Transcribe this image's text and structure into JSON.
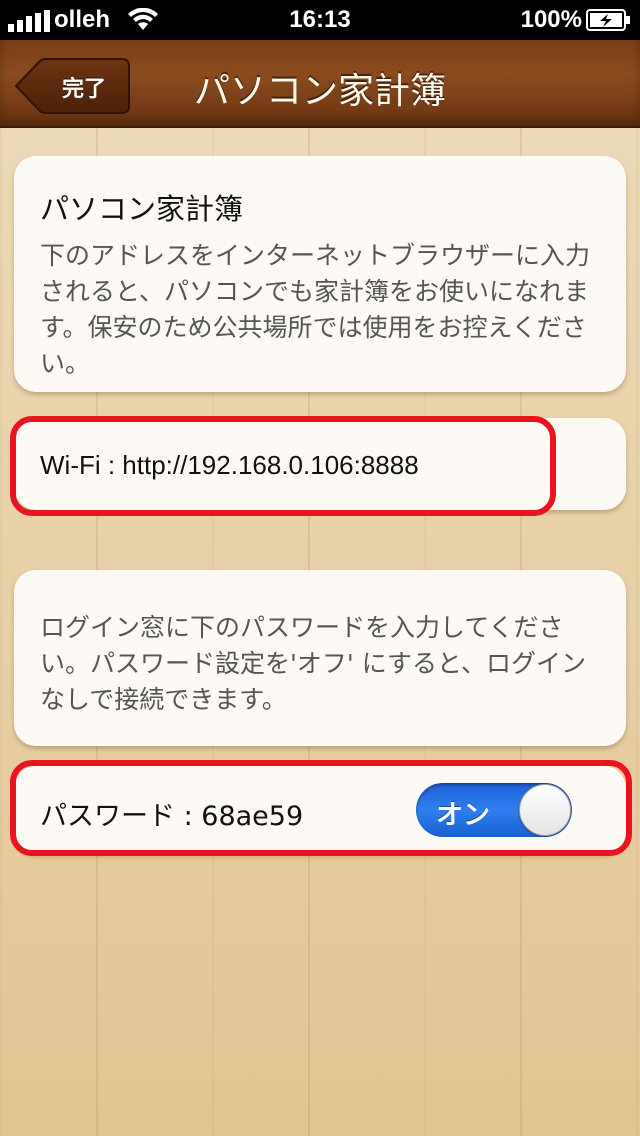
{
  "status_bar": {
    "carrier": "olleh",
    "time": "16:13",
    "battery": "100%"
  },
  "nav": {
    "back_label": "完了",
    "title": "パソコン家計簿"
  },
  "intro": {
    "title": "パソコン家計簿",
    "description": "下のアドレスをインターネットブラウザーに入力されると、パソコンでも家計簿をお使いになれます。保安のため公共場所では使用をお控えください。"
  },
  "wifi": {
    "url": "Wi-Fi : http://192.168.0.106:8888"
  },
  "password_section": {
    "description": "ログイン窓に下のパスワードを入力してください。パスワード設定を'オフ' にすると、ログインなしで接続できます。",
    "label": "パスワード : 68ae59",
    "toggle_label": "オン",
    "toggle_on": true
  },
  "colors": {
    "nav_bg": "#7a3e16",
    "toggle_on": "#2f7ff0",
    "highlight": "#e8141e"
  }
}
